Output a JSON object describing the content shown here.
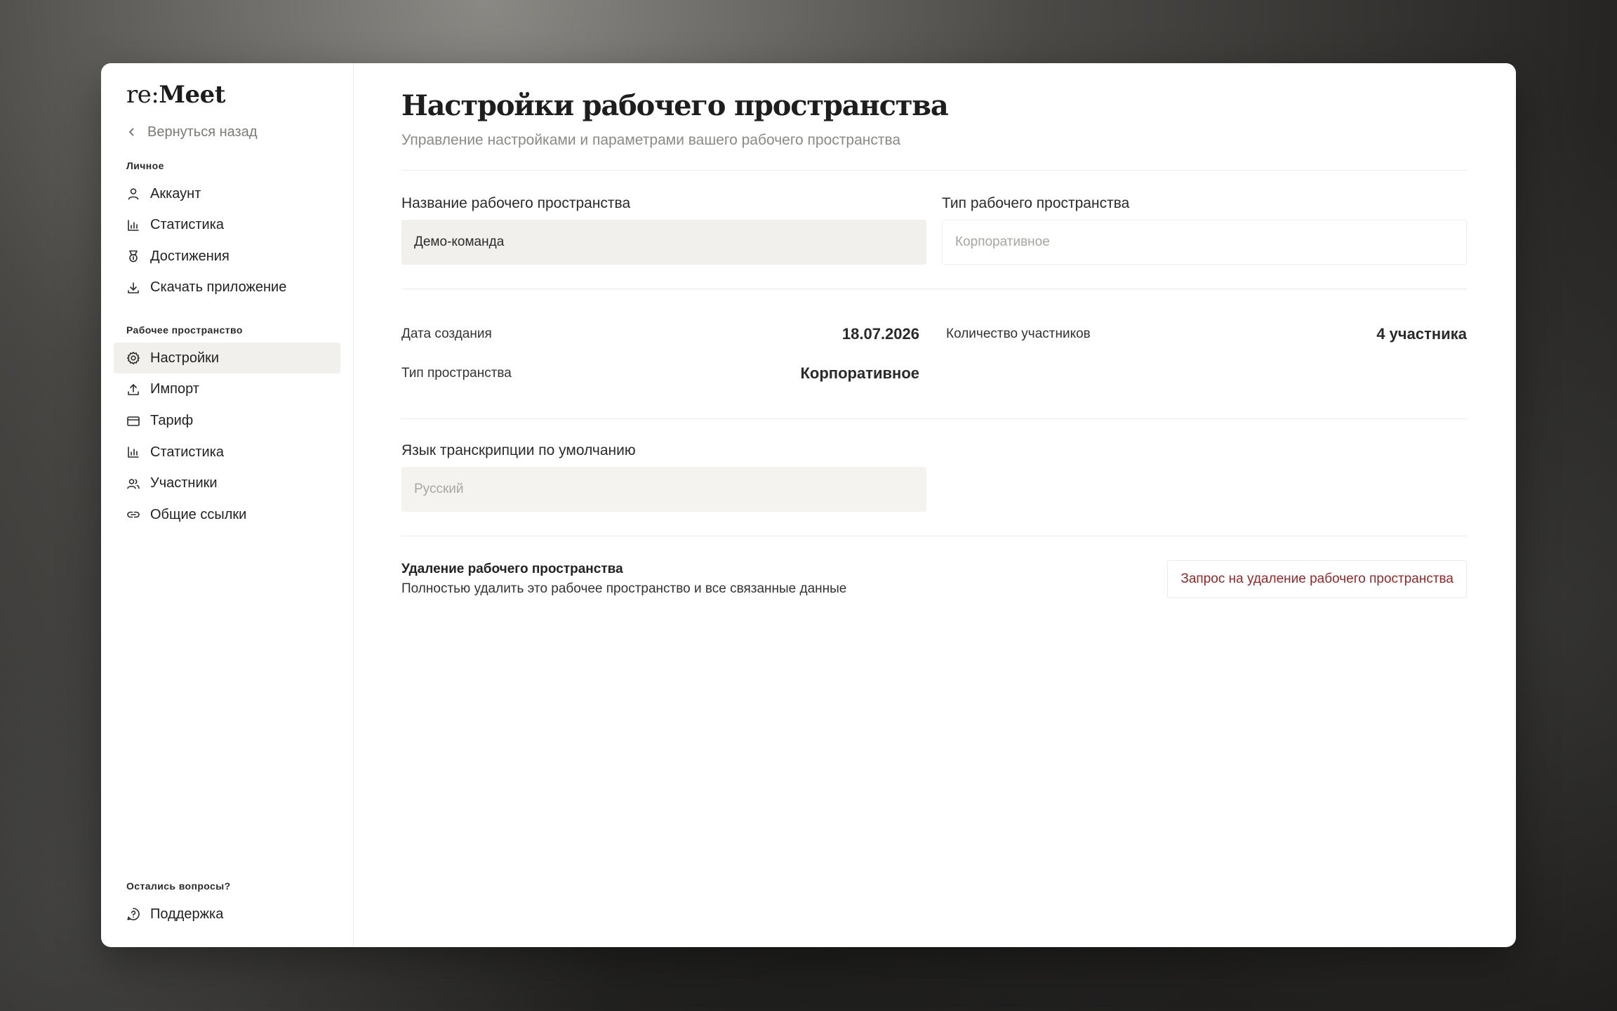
{
  "app": {
    "logo_light": "re:",
    "logo_bold": "Meet"
  },
  "sidebar": {
    "back_label": "Вернуться назад",
    "personal_title": "Личное",
    "personal_items": [
      {
        "label": "Аккаунт",
        "icon": "user-icon"
      },
      {
        "label": "Статистика",
        "icon": "bar-chart-icon"
      },
      {
        "label": "Достижения",
        "icon": "medal-icon"
      },
      {
        "label": "Скачать приложение",
        "icon": "download-icon"
      }
    ],
    "workspace_title": "Рабочее пространство",
    "workspace_items": [
      {
        "label": "Настройки",
        "icon": "gear-icon",
        "active": true
      },
      {
        "label": "Импорт",
        "icon": "upload-icon"
      },
      {
        "label": "Тариф",
        "icon": "credit-card-icon"
      },
      {
        "label": "Статистика",
        "icon": "bar-chart-icon"
      },
      {
        "label": "Участники",
        "icon": "users-icon"
      },
      {
        "label": "Общие ссылки",
        "icon": "link-icon"
      }
    ],
    "help_title": "Остались вопросы?",
    "support_label": "Поддержка"
  },
  "main": {
    "title": "Настройки рабочего пространства",
    "subtitle": "Управление настройками и параметрами вашего рабочего пространства",
    "name_field": {
      "label": "Название рабочего пространства",
      "value": "Демо-команда"
    },
    "type_field": {
      "label": "Тип рабочего пространства",
      "placeholder": "Корпоративное"
    },
    "info": {
      "created_label": "Дата создания",
      "created_value": "18.07.2026",
      "members_label": "Количество участников",
      "members_value": "4 участника",
      "space_type_label": "Тип пространства",
      "space_type_value": "Корпоративное"
    },
    "language_field": {
      "label": "Язык транскрипции по умолчанию",
      "value": "Русский"
    },
    "danger": {
      "title": "Удаление рабочего пространства",
      "description": "Полностью удалить это рабочее пространство и все связанные данные",
      "button_label": "Запрос на удаление рабочего пространства",
      "button_color": "#8f2a2a"
    }
  }
}
